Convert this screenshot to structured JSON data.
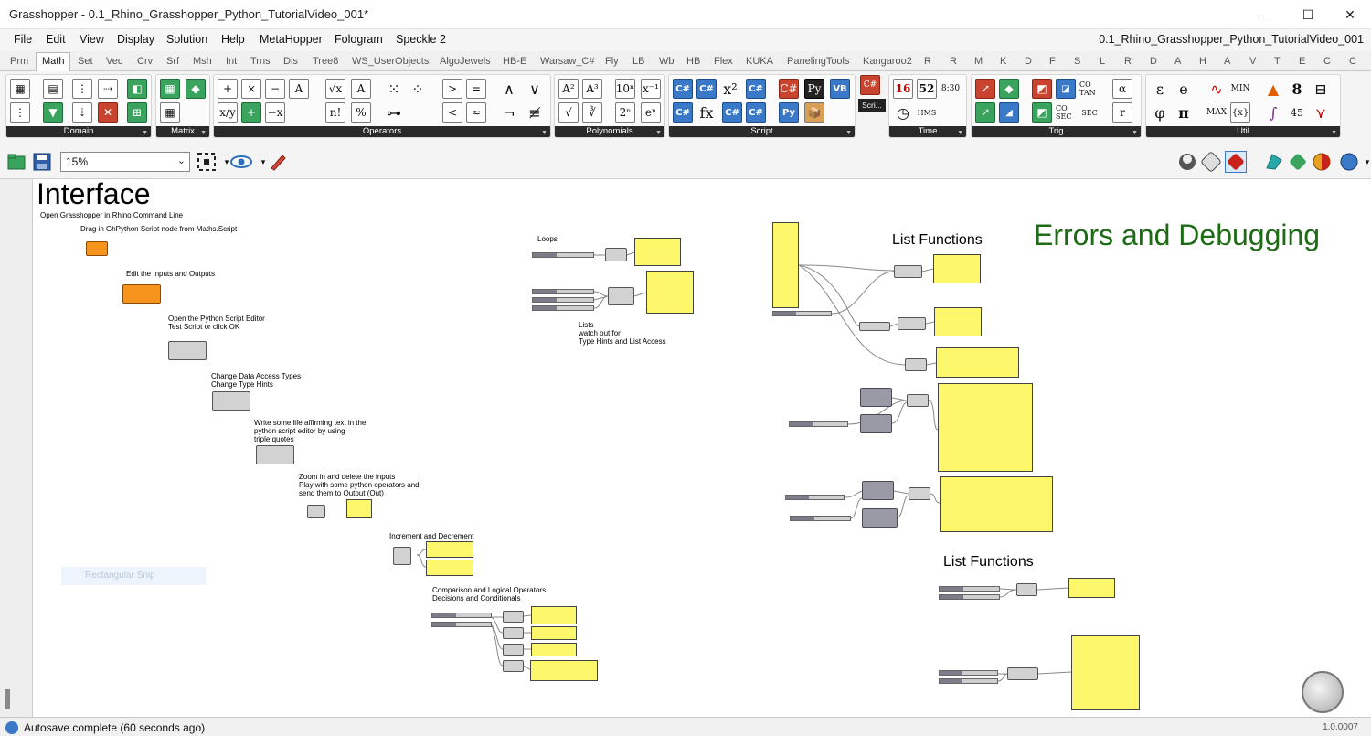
{
  "window": {
    "title": "Grasshopper - 0.1_Rhino_Grasshopper_Python_TutorialVideo_001*",
    "minimize": "—",
    "maximize": "☐",
    "close": "✕"
  },
  "menubar": {
    "items": [
      "File",
      "Edit",
      "View",
      "Display",
      "Solution",
      "Help",
      "MetaHopper",
      "Fologram",
      "Speckle 2"
    ],
    "document_name": "0.1_Rhino_Grasshopper_Python_TutorialVideo_001"
  },
  "tabs": [
    "Prm",
    "Math",
    "Set",
    "Vec",
    "Crv",
    "Srf",
    "Msh",
    "Int",
    "Trns",
    "Dis",
    "Tree8",
    "WS_UserObjects",
    "AlgoJewels",
    "HB-E",
    "Warsaw_C#",
    "Fly",
    "LB",
    "Wb",
    "HB",
    "Flex",
    "KUKA",
    "PanelingTools",
    "Kangaroo2",
    "R",
    "R",
    "M",
    "K",
    "D",
    "F",
    "S",
    "L",
    "R",
    "D",
    "A",
    "H",
    "A",
    "V",
    "T",
    "E",
    "C",
    "C"
  ],
  "active_tab": "Math",
  "ribbon_groups": [
    "Domain",
    "Matrix",
    "Operators",
    "Polynomials",
    "Script",
    "Time",
    "Trig",
    "Util"
  ],
  "ribbon_tooltip": "Scri...",
  "ribbon_icons": {
    "operators": [
      "+",
      "×",
      "−",
      "A",
      "√x",
      "A",
      "x/y",
      "+",
      "−x",
      "n!",
      "%",
      ">",
      "=",
      "<",
      "≈",
      "∧",
      "∨",
      "¬",
      "≢"
    ],
    "polynomials": [
      "A²",
      "A³",
      "10ⁿ",
      "x⁻¹",
      "√",
      "∛",
      "2ⁿ",
      "eⁿ"
    ],
    "script": [
      "C#",
      "C#",
      "x²",
      "C#",
      "C#",
      "fx",
      "C#",
      "C#",
      "C#",
      "Py",
      "VB",
      "Py",
      "📦"
    ],
    "time": [
      "16",
      "52",
      "8:30",
      "HMS"
    ],
    "trig": [
      "CO TAN",
      "CO SEC",
      "SEC",
      "α",
      "r"
    ],
    "util": [
      "ε",
      "e",
      "MIN",
      "8",
      "φ",
      "π",
      "MAX",
      "{x}",
      "45"
    ]
  },
  "canvas_toolbar": {
    "zoom": "15%"
  },
  "canvas": {
    "heading": "Interface",
    "list_functions_1": "List Functions",
    "list_functions_2": "List Functions",
    "errors_heading": "Errors and Debugging",
    "notes": [
      "Open Grasshopper in Rhino Command Line",
      "Drag in GhPython Script node from Maths.Script",
      "Edit the Inputs and Outputs",
      "Open the Python Script Editor\nTest Script or click OK",
      "Change Data Access Types\nChange Type Hints",
      "Write some life affirming text in the\npython script editor by using\ntriple quotes",
      "Zoom in and delete the inputs\nPlay with some python operators and\nsend them to Output (Out)",
      "Increment and Decrement",
      "Comparison and Logical Operators\nDecisions and Conditionals",
      "Loops",
      "Lists\nwatch out for\nType Hints and List Access"
    ],
    "snip_label": "Rectangular Snip"
  },
  "status": {
    "text": "Autosave complete (60 seconds ago)",
    "version": "1.0.0007"
  },
  "colors": {
    "panel": "#fcf76b",
    "script_node": "#f7941d",
    "green_heading": "#1e6b16",
    "group_label": "#2b2b2b"
  }
}
